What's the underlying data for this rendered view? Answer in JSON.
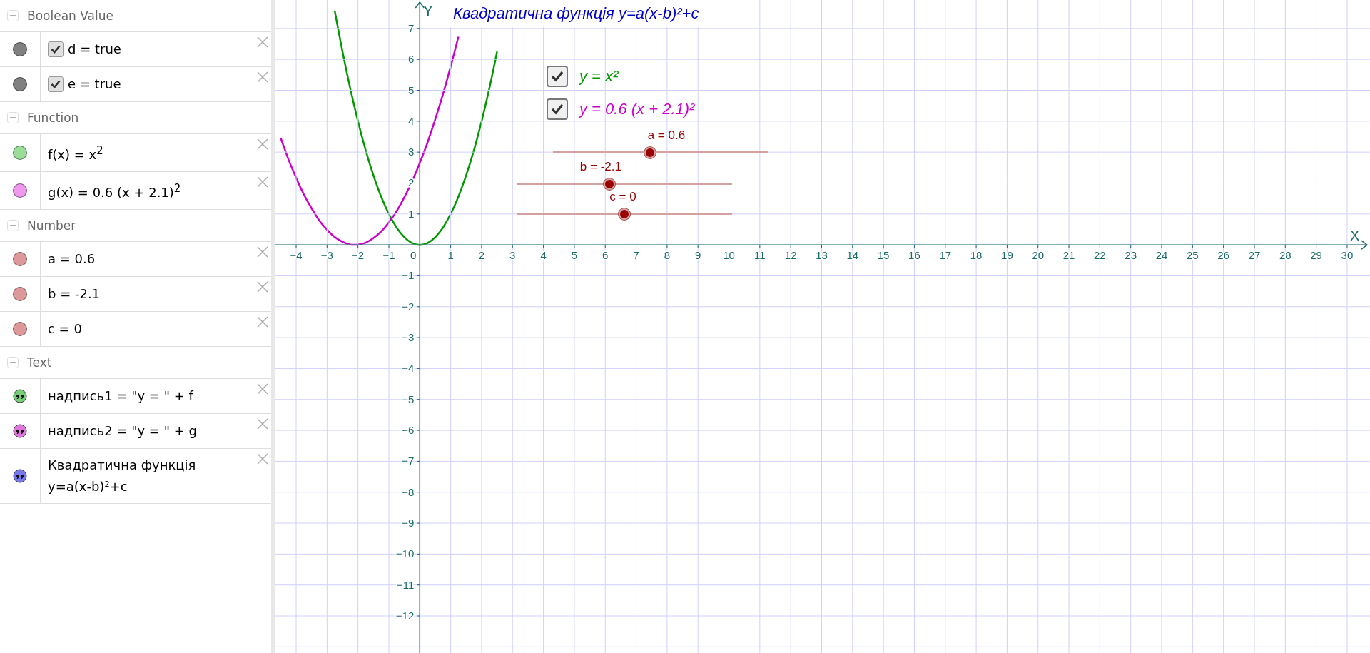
{
  "algebra_view": {
    "groups": [
      {
        "title": "Boolean Value",
        "expanded": true,
        "items": [
          {
            "kind": "boolean",
            "color": "#808080",
            "checked": true,
            "text": "d = true"
          },
          {
            "kind": "boolean",
            "color": "#808080",
            "checked": true,
            "text": "e = true"
          }
        ]
      },
      {
        "title": "Function",
        "expanded": true,
        "items": [
          {
            "kind": "function",
            "color": "#99dd99",
            "text": "f(x) = x$^{2}$"
          },
          {
            "kind": "function",
            "color": "#ee99ee",
            "text": "g(x) = 0.6 (x + 2.1)$^{2}$"
          }
        ]
      },
      {
        "title": "Number",
        "expanded": true,
        "items": [
          {
            "kind": "number",
            "color": "#dd9999",
            "text": "a = 0.6"
          },
          {
            "kind": "number",
            "color": "#dd9999",
            "text": "b = -2.1"
          },
          {
            "kind": "number",
            "color": "#dd9999",
            "text": "c = 0"
          }
        ]
      },
      {
        "title": "Text",
        "expanded": true,
        "items": [
          {
            "kind": "text",
            "color": "#77cc77",
            "text": "надпись1 = \"y = \" + f"
          },
          {
            "kind": "text",
            "color": "#dd77dd",
            "text": "надпись2 = \"y = \" + g"
          },
          {
            "kind": "text",
            "color": "#7777ee",
            "text": "Квадратична функція y=a(x-b)²+c"
          }
        ]
      }
    ]
  },
  "graphics_view": {
    "title": "Квадратична функція y=a(x-b)²+c",
    "checkboxes": [
      {
        "label": "y = x²",
        "checked": true,
        "color": "#009900"
      },
      {
        "label": "y = 0.6 (x + 2.1)²",
        "checked": true,
        "color": "#cc00cc"
      }
    ],
    "sliders": [
      {
        "label": "a = 0.6",
        "level": 0.45
      },
      {
        "label": "b = -2.1",
        "level": 0.43
      },
      {
        "label": "c = 0",
        "level": 0.5
      }
    ],
    "axis_labels": {
      "x": "X",
      "y": "Y",
      "origin": "0"
    },
    "chart_data": {
      "type": "line",
      "x": [
        -4.5,
        -4.25,
        -4,
        -3.75,
        -3.5,
        -3.25,
        -3,
        -2.75,
        -2.5,
        -2.25,
        -2,
        -1.75,
        -1.5,
        -1.25,
        -1,
        -0.75,
        -0.5,
        -0.25,
        0,
        0.25,
        0.5,
        0.75,
        1,
        1.25,
        1.5,
        1.75,
        2,
        2.25,
        2.5
      ],
      "series": [
        {
          "color": "#009900",
          "values": [
            null,
            null,
            null,
            null,
            null,
            null,
            null,
            7.56,
            6.25,
            5.06,
            4,
            3.06,
            2.25,
            1.56,
            1,
            0.56,
            0.25,
            0.06,
            0,
            0.06,
            0.25,
            0.56,
            1,
            1.56,
            2.25,
            3.06,
            4,
            5.06,
            6.25
          ]
        },
        {
          "color": "#cc00cc",
          "values": [
            3.46,
            2.77,
            2.17,
            1.63,
            1.18,
            0.79,
            0.49,
            0.25,
            0.1,
            0.01,
            0.01,
            0.07,
            0.22,
            0.43,
            0.73,
            1.09,
            1.54,
            2.05,
            2.65,
            3.31,
            4.06,
            4.87,
            5.77,
            6.73,
            null,
            null,
            null,
            null,
            null
          ]
        }
      ],
      "grid": true,
      "xlim": [
        -4.67,
        30.74
      ],
      "ylim": [
        -13.2,
        7.92
      ],
      "xticks": [
        {
          "value": -4,
          "label": "−4"
        },
        {
          "value": -3,
          "label": "−3"
        },
        {
          "value": -2,
          "label": "−2"
        },
        {
          "value": -1,
          "label": "−1"
        },
        {
          "value": 1,
          "label": "1"
        },
        {
          "value": 2,
          "label": "2"
        },
        {
          "value": 3,
          "label": "3"
        },
        {
          "value": 4,
          "label": "4"
        },
        {
          "value": 5,
          "label": "5"
        },
        {
          "value": 6,
          "label": "6"
        },
        {
          "value": 7,
          "label": "7"
        },
        {
          "value": 8,
          "label": "8"
        },
        {
          "value": 9,
          "label": "9"
        },
        {
          "value": 10,
          "label": "10"
        },
        {
          "value": 11,
          "label": "11"
        },
        {
          "value": 12,
          "label": "12"
        },
        {
          "value": 13,
          "label": "13"
        },
        {
          "value": 14,
          "label": "14"
        },
        {
          "value": 15,
          "label": "15"
        },
        {
          "value": 16,
          "label": "16"
        },
        {
          "value": 17,
          "label": "17"
        },
        {
          "value": 18,
          "label": "18"
        },
        {
          "value": 19,
          "label": "19"
        },
        {
          "value": 20,
          "label": "20"
        },
        {
          "value": 21,
          "label": "21"
        },
        {
          "value": 22,
          "label": "22"
        },
        {
          "value": 23,
          "label": "23"
        },
        {
          "value": 24,
          "label": "24"
        },
        {
          "value": 25,
          "label": "25"
        },
        {
          "value": 26,
          "label": "26"
        },
        {
          "value": 27,
          "label": "27"
        },
        {
          "value": 28,
          "label": "28"
        },
        {
          "value": 29,
          "label": "29"
        },
        {
          "value": 30,
          "label": "30"
        }
      ],
      "yticks": [
        {
          "value": -12,
          "label": "−12"
        },
        {
          "value": -11,
          "label": "−11"
        },
        {
          "value": -10,
          "label": "−10"
        },
        {
          "value": -9,
          "label": "−9"
        },
        {
          "value": -8,
          "label": "−8"
        },
        {
          "value": -7,
          "label": "−7"
        },
        {
          "value": -6,
          "label": "−6"
        },
        {
          "value": -5,
          "label": "−5"
        },
        {
          "value": -4,
          "label": "−4"
        },
        {
          "value": -3,
          "label": "−3"
        },
        {
          "value": -2,
          "label": "−2"
        },
        {
          "value": -1,
          "label": "−1"
        },
        {
          "value": 1,
          "label": "1"
        },
        {
          "value": 2,
          "label": "2"
        },
        {
          "value": 3,
          "label": "3"
        },
        {
          "value": 4,
          "label": "4"
        },
        {
          "value": 5,
          "label": "5"
        },
        {
          "value": 6,
          "label": "6"
        },
        {
          "value": 7,
          "label": "7"
        }
      ]
    }
  }
}
